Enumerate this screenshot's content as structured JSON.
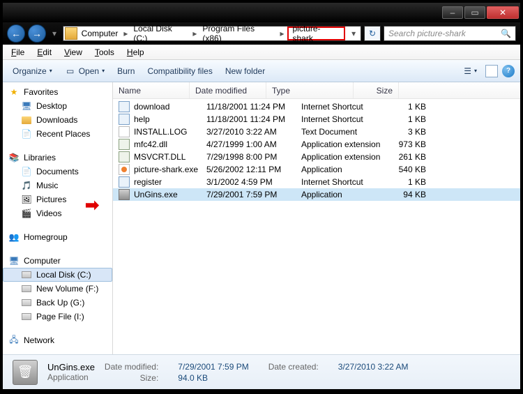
{
  "titlebar": {
    "min": "–",
    "max": "▭",
    "close": "✕"
  },
  "address": {
    "back": "←",
    "fwd": "→",
    "dd": "▾",
    "refresh": "↻",
    "crumbs": [
      "Computer",
      "Local Disk (C:)",
      "Program Files (x86)",
      "picture-shark"
    ],
    "search_placeholder": "Search picture-shark"
  },
  "menu": {
    "file": "File",
    "edit": "Edit",
    "view": "View",
    "tools": "Tools",
    "help": "Help"
  },
  "toolbar": {
    "organize": "Organize",
    "open": "Open",
    "burn": "Burn",
    "compat": "Compatibility files",
    "newfolder": "New folder",
    "dd": "▾",
    "help": "?"
  },
  "nav": {
    "favorites": "Favorites",
    "fav_items": [
      "Desktop",
      "Downloads",
      "Recent Places"
    ],
    "libraries": "Libraries",
    "lib_items": [
      "Documents",
      "Music",
      "Pictures",
      "Videos"
    ],
    "homegroup": "Homegroup",
    "computer": "Computer",
    "drives": [
      "Local Disk (C:)",
      "New Volume (F:)",
      "Back Up (G:)",
      "Page File (I:)"
    ],
    "network": "Network"
  },
  "columns": {
    "name": "Name",
    "date": "Date modified",
    "type": "Type",
    "size": "Size"
  },
  "files": [
    {
      "ic": "web",
      "name": "download",
      "date": "11/18/2001 11:24 PM",
      "type": "Internet Shortcut",
      "size": "1 KB"
    },
    {
      "ic": "web",
      "name": "help",
      "date": "11/18/2001 11:24 PM",
      "type": "Internet Shortcut",
      "size": "1 KB"
    },
    {
      "ic": "txt",
      "name": "INSTALL.LOG",
      "date": "3/27/2010 3:22 AM",
      "type": "Text Document",
      "size": "3 KB"
    },
    {
      "ic": "dll",
      "name": "mfc42.dll",
      "date": "4/27/1999 1:00 AM",
      "type": "Application extension",
      "size": "973 KB"
    },
    {
      "ic": "dll",
      "name": "MSVCRT.DLL",
      "date": "7/29/1998 8:00 PM",
      "type": "Application extension",
      "size": "261 KB"
    },
    {
      "ic": "exe1",
      "name": "picture-shark.exe",
      "date": "5/26/2002 12:11 PM",
      "type": "Application",
      "size": "540 KB"
    },
    {
      "ic": "web",
      "name": "register",
      "date": "3/1/2002 4:59 PM",
      "type": "Internet Shortcut",
      "size": "1 KB"
    },
    {
      "ic": "uninst",
      "name": "UnGins.exe",
      "date": "7/29/2001 7:59 PM",
      "type": "Application",
      "size": "94 KB"
    }
  ],
  "selected_index": 7,
  "details": {
    "name": "UnGins.exe",
    "type": "Application",
    "modified_lbl": "Date modified:",
    "modified": "7/29/2001 7:59 PM",
    "size_lbl": "Size:",
    "size": "94.0 KB",
    "created_lbl": "Date created:",
    "created": "3/27/2010 3:22 AM"
  },
  "arrow": "➡"
}
